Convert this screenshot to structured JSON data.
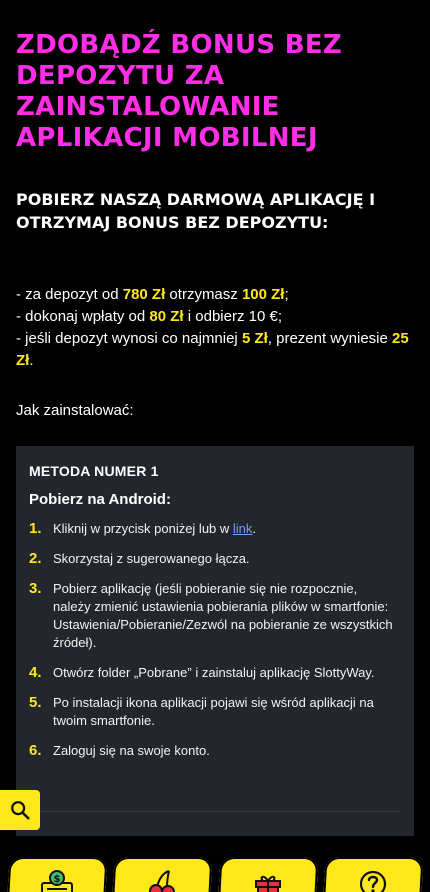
{
  "hero": {
    "title": "ZDOBĄDŹ BONUS BEZ DEPOZYTU ZA ZAINSTALOWANIE APLIKACJI MOBILNEJ"
  },
  "intro": {
    "subheading": "POBIERZ NASZĄ DARMOWĄ APLIKACJĘ I OTRZYMAJ BONUS BEZ DEPOZYTU:"
  },
  "bonuses": {
    "l1_a": "- za depozyt od ",
    "l1_v1": "780 Zł",
    "l1_b": " otrzymasz ",
    "l1_v2": "100 Zł",
    "l1_c": ";",
    "l2_a": "- dokonaj wpłaty od ",
    "l2_v1": "80 Zł",
    "l2_b": " i odbierz 10 €;",
    "l3_a": "- jeśli depozyt wynosi co najmniej ",
    "l3_v1": "5 Zł",
    "l3_b": ", prezent wyniesie ",
    "l3_v2": "25 Zł",
    "l3_c": "."
  },
  "how_to": "Jak zainstalować:",
  "method": {
    "title": "METODA NUMER 1",
    "subtitle": "Pobierz na Android:",
    "steps": [
      {
        "num": "1.",
        "text_a": "Kliknij w przycisk poniżej lub w ",
        "link": "link",
        "text_b": "."
      },
      {
        "num": "2.",
        "text": "Skorzystaj z sugerowanego łącza."
      },
      {
        "num": "3.",
        "text": "Pobierz aplikację (jeśli pobieranie się nie rozpocznie, należy zmienić ustawienia pobierania plików w smartfonie: Ustawienia/Pobieranie/Zezwól na pobieranie ze wszystkich źródeł)."
      },
      {
        "num": "4.",
        "text": "Otwórz folder „Pobrane” i zainstaluj aplikację SlottyWay."
      },
      {
        "num": "5.",
        "text": "Po instalacji ikona aplikacji pojawi się wśród aplikacji na twoim smartfonie."
      },
      {
        "num": "6.",
        "text": "Zaloguj się na swoje konto."
      }
    ]
  },
  "nav": {
    "items": [
      {
        "icon": "money-icon"
      },
      {
        "icon": "cherries-icon"
      },
      {
        "icon": "gift-icon"
      },
      {
        "icon": "help-icon"
      }
    ]
  },
  "colors": {
    "accent_pink": "#ff2ee6",
    "accent_yellow": "#ffe81a",
    "background": "#000000",
    "card": "#23262d"
  }
}
